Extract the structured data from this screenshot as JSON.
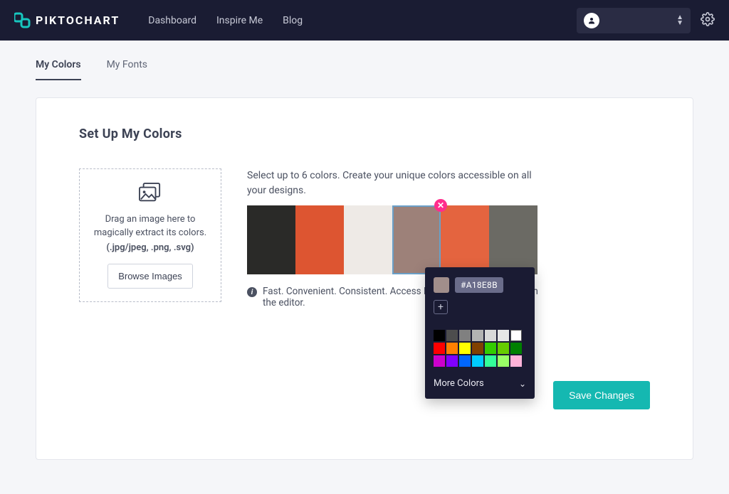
{
  "brand": "PIKTOCHART",
  "nav": {
    "dashboard": "Dashboard",
    "inspire": "Inspire Me",
    "blog": "Blog"
  },
  "tabs": {
    "colors": "My Colors",
    "fonts": "My Fonts"
  },
  "page": {
    "title": "Set Up My Colors",
    "dropzone_line1": "Drag an image here to magically extract its colors.",
    "dropzone_formats": "(.jpg/jpeg, .png, .svg)",
    "browse_label": "Browse Images",
    "instructions": "Select up to 6 colors. Create your unique colors accessible on all your designs.",
    "note": "Fast. Convenient. Consistent. Access My Colors anywhere within the editor.",
    "save_label": "Save Changes"
  },
  "swatches": [
    {
      "hex": "#2a2a28"
    },
    {
      "hex": "#dd5531"
    },
    {
      "hex": "#eeeae6"
    },
    {
      "hex": "#9d8179",
      "selected": true
    },
    {
      "hex": "#e4643f"
    },
    {
      "hex": "#6b6a64"
    }
  ],
  "picker": {
    "current_hex": "#A18E8B",
    "current_color": "#a18e8b",
    "more_label": "More Colors",
    "palette": [
      "#000000",
      "#4d4d4d",
      "#808080",
      "#b3b3b3",
      "#d9d9d9",
      "#e6e6e6",
      "#ffffff",
      "#ff0000",
      "#ff8000",
      "#ffff00",
      "#804000",
      "#33cc00",
      "#66cc00",
      "#008000",
      "#cc00cc",
      "#8000ff",
      "#0066ff",
      "#00ccff",
      "#33ff99",
      "#99ff66",
      "#ffb3d9"
    ]
  },
  "colors": {
    "accent": "#15b8b1"
  }
}
